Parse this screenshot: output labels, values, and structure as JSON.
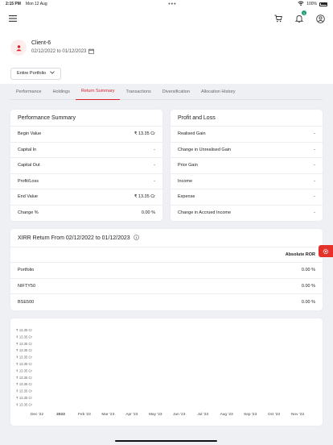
{
  "status_bar": {
    "time": "2:15 PM",
    "date": "Mon 12 Aug",
    "dots": "•••",
    "battery": "100%"
  },
  "header": {
    "cart_badge": "",
    "bell_badge": "1"
  },
  "client": {
    "name": "Client-6",
    "dates": "02/12/2022 to 01/12/2023"
  },
  "portfolio_select": {
    "label": "Entire Portfolio"
  },
  "tabs": [
    "Performance",
    "Holdings",
    "Return Summary",
    "Transactions",
    "Diversification",
    "Allocation History"
  ],
  "performance_summary": {
    "title": "Performance Summary",
    "rows": [
      {
        "label": "Begin Value",
        "value": "₹ 13.35 Cr"
      },
      {
        "label": "Capital In",
        "value": "-"
      },
      {
        "label": "Capital Out",
        "value": "-"
      },
      {
        "label": "Profit/Loss",
        "value": "-"
      },
      {
        "label": "End Value",
        "value": "₹ 13.35 Cr"
      },
      {
        "label": "Change %",
        "value": "0.00 %"
      }
    ]
  },
  "profit_loss": {
    "title": "Profit and Loss",
    "rows": [
      {
        "label": "Realised Gain",
        "value": "-"
      },
      {
        "label": "Change in Unrealised Gain",
        "value": "-"
      },
      {
        "label": "Prior Gain",
        "value": "-"
      },
      {
        "label": "Income",
        "value": "-"
      },
      {
        "label": "Expense",
        "value": "-"
      },
      {
        "label": "Change in Accrued Income",
        "value": "-"
      }
    ]
  },
  "xirr": {
    "title": "XIRR Return From 02/12/2022 to 01/12/2023",
    "column": "Absolute ROR",
    "rows": [
      {
        "label": "Portfolio",
        "value": "0.00 %"
      },
      {
        "label": "NIFTY50",
        "value": "0.00 %"
      },
      {
        "label": "BSE500",
        "value": "0.00 %"
      }
    ]
  },
  "chart_data": {
    "type": "line",
    "y_tick_labels": [
      "₹ 13.35 Cr",
      "₹ 13.35 Cr",
      "₹ 13.35 Cr",
      "₹ 13.35 Cr",
      "₹ 13.35 Cr",
      "₹ 13.35 Cr",
      "₹ 13.35 Cr",
      "₹ 13.35 Cr",
      "₹ 13.35 Cr",
      "₹ 13.35 Cr",
      "₹ 13.35 Cr",
      "₹ 13.35 Cr"
    ],
    "x_tick_labels": [
      "Dec '22",
      "2023",
      "Feb '23",
      "Mar '23",
      "Apr '23",
      "May '23",
      "Jun '23",
      "Jul '23",
      "Aug '23",
      "Sep '23",
      "Oct '23",
      "Nov '23"
    ],
    "bold_ticks": [
      "2023"
    ],
    "series": []
  },
  "colors": {
    "accent": "#d8232a",
    "badge": "#1a9e6e",
    "background": "#eef0f4"
  }
}
